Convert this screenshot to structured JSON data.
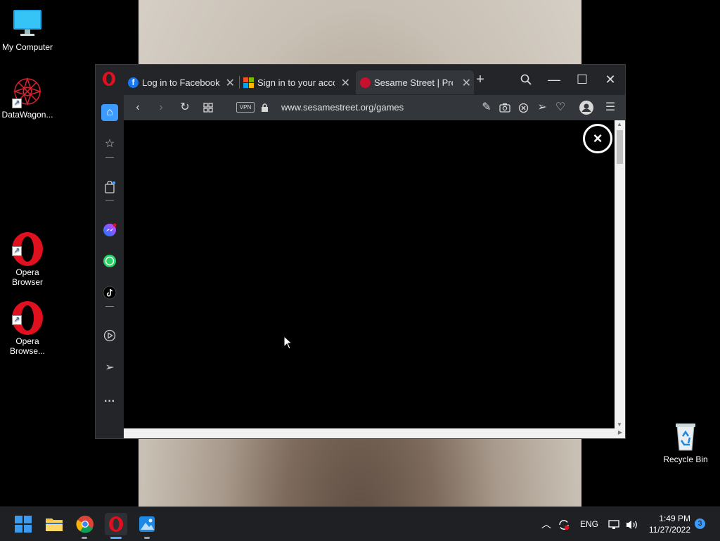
{
  "desktop": {
    "icons": [
      {
        "label": "My Computer"
      },
      {
        "label": "DataWagon..."
      },
      {
        "label": "Opera\nBrowser"
      },
      {
        "label": "Opera\nBrowse..."
      },
      {
        "label": "Recycle Bin"
      }
    ]
  },
  "browser": {
    "tabs": [
      {
        "title": "Log in to Facebook",
        "icon": "facebook-icon"
      },
      {
        "title": "Sign in to your acco",
        "icon": "microsoft-icon"
      },
      {
        "title": "Sesame Street | Pres",
        "icon": "sesame-street-icon",
        "active": true
      }
    ],
    "new_tab_symbol": "+",
    "vpn_label": "VPN",
    "url": "www.sesamestreet.org/games",
    "close_overlay_symbol": "×"
  },
  "taskbar": {
    "language": "ENG",
    "time": "1:49 PM",
    "date": "11/27/2022",
    "notification_count": "3"
  },
  "colors": {
    "opera_red": "#e0101e",
    "browser_dark": "#232529",
    "accent_blue": "#3d9bff"
  }
}
